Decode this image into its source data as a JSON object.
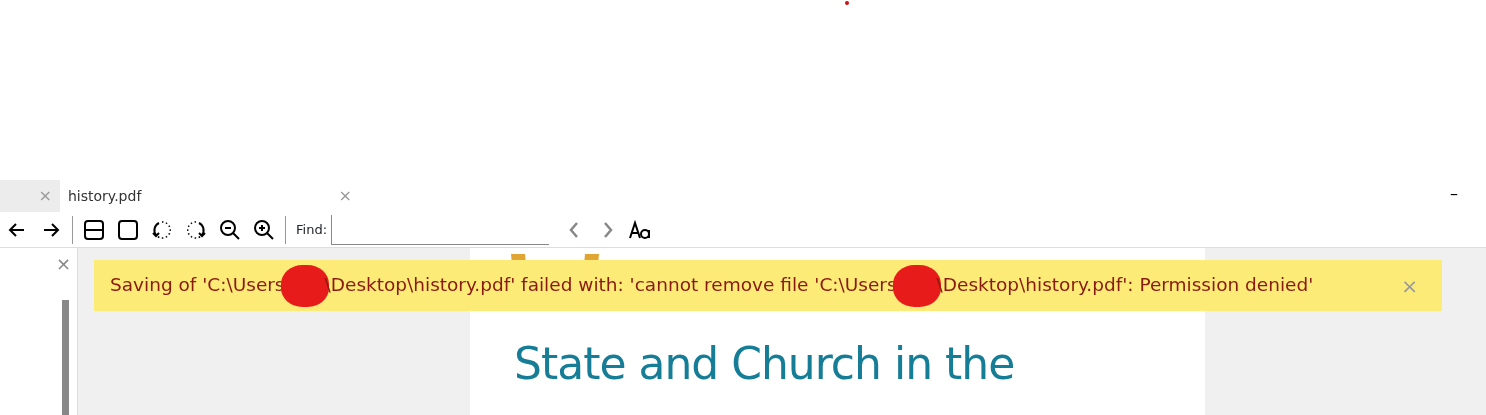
{
  "tabs": [
    {
      "close": "×",
      "selected": false
    },
    {
      "label": "history.pdf",
      "close": "×",
      "selected": true
    }
  ],
  "window": {
    "minimize": "–"
  },
  "toolbar": {
    "find_label": "Find:"
  },
  "sidebar": {
    "close": "×"
  },
  "banner": {
    "close": "×",
    "parts": [
      {
        "kind": "text",
        "text": "Saving of 'C:\\Users"
      },
      {
        "kind": "redaction"
      },
      {
        "kind": "text",
        "text": "\\Desktop\\history.pdf' failed with: 'cannot remove file 'C:\\Users"
      },
      {
        "kind": "redaction"
      },
      {
        "kind": "text",
        "text": "\\Desktop\\history.pdf': Permission denied'"
      }
    ]
  },
  "document": {
    "heading": "State and Church in the"
  }
}
